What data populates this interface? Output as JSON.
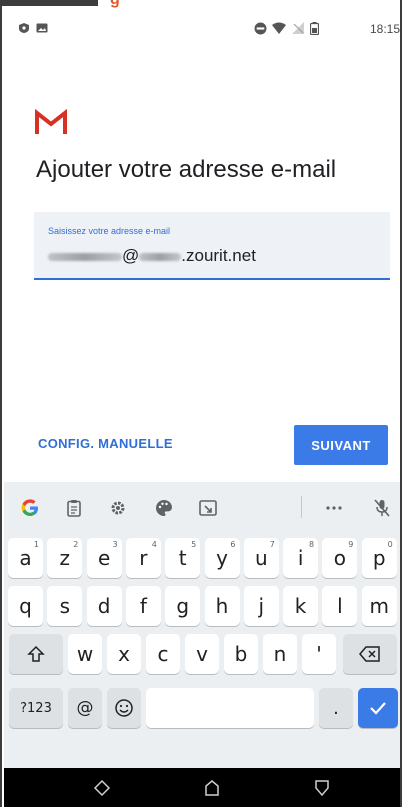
{
  "status_bar": {
    "time": "18:15",
    "left_icons": [
      "app-notification-icon",
      "image-notification-icon"
    ],
    "right_icons": [
      "do-not-disturb-icon",
      "wifi-icon",
      "no-signal-icon",
      "battery-icon"
    ]
  },
  "header_banner": {
    "text": "g"
  },
  "app": {
    "logo": "gmail-logo",
    "title": "Ajouter votre adresse e-mail",
    "email_field": {
      "label": "Saisissez votre adresse e-mail",
      "value_visible_suffix": ".zourit.net",
      "value_at": "@"
    },
    "manual_config_label": "CONFIG. MANUELLE",
    "next_label": "SUIVANT",
    "accent_color": "#3b7be8"
  },
  "keyboard": {
    "toolbar": [
      "google-icon",
      "clipboard-icon",
      "settings-icon",
      "palette-icon",
      "screenshot-icon",
      "more-icon",
      "mic-off-icon"
    ],
    "row1": [
      {
        "k": "a",
        "n": "1"
      },
      {
        "k": "z",
        "n": "2"
      },
      {
        "k": "e",
        "n": "3"
      },
      {
        "k": "r",
        "n": "4"
      },
      {
        "k": "t",
        "n": "5"
      },
      {
        "k": "y",
        "n": "6"
      },
      {
        "k": "u",
        "n": "7"
      },
      {
        "k": "i",
        "n": "8"
      },
      {
        "k": "o",
        "n": "9"
      },
      {
        "k": "p",
        "n": "0"
      }
    ],
    "row2": [
      "q",
      "s",
      "d",
      "f",
      "g",
      "h",
      "j",
      "k",
      "l",
      "m"
    ],
    "row3": [
      "w",
      "x",
      "c",
      "v",
      "b",
      "n",
      "'"
    ],
    "row4": {
      "symbols": "?123",
      "at": "@",
      "period": "."
    }
  },
  "nav_bar": [
    "back-icon",
    "home-icon",
    "recents-icon"
  ]
}
